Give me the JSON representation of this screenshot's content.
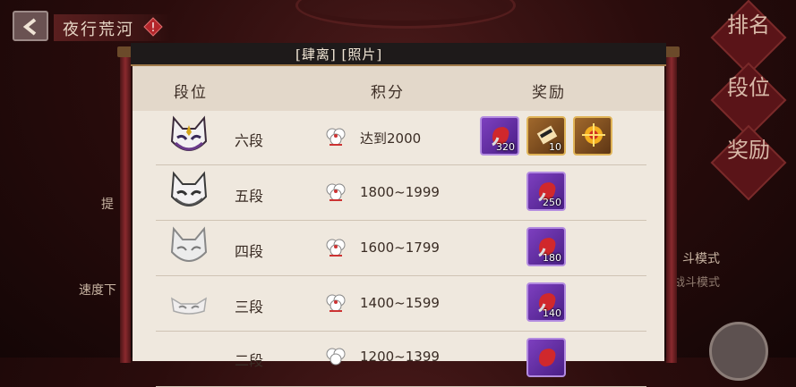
{
  "header": {
    "title": "夜行荒河"
  },
  "side_banners": [
    "排名",
    "段位",
    "奖励"
  ],
  "background_texts": {
    "left_1": "提",
    "left_2": "速度下",
    "right_1": "斗模式",
    "right_2": "战斗模式"
  },
  "scroll": {
    "title": "[肆离] [照片]"
  },
  "table": {
    "headers": {
      "rank": "段位",
      "score": "积分",
      "reward": "奖励"
    },
    "rows": [
      {
        "rank": "六段",
        "score": "达到2000",
        "rewards": [
          {
            "type": "purple",
            "icon": "red-bird-icon",
            "count": "320"
          },
          {
            "type": "gold",
            "icon": "scroll-item-icon",
            "count": "10"
          },
          {
            "type": "gold",
            "icon": "spark-item-icon",
            "count": ""
          }
        ]
      },
      {
        "rank": "五段",
        "score": "1800~1999",
        "rewards": [
          {
            "type": "purple",
            "icon": "red-bird-icon",
            "count": "250"
          }
        ]
      },
      {
        "rank": "四段",
        "score": "1600~1799",
        "rewards": [
          {
            "type": "purple",
            "icon": "red-bird-icon",
            "count": "180"
          }
        ]
      },
      {
        "rank": "三段",
        "score": "1400~1599",
        "rewards": [
          {
            "type": "purple",
            "icon": "red-bird-icon",
            "count": "140"
          }
        ]
      },
      {
        "rank": "二段",
        "score": "1200~1399",
        "rewards": [
          {
            "type": "purple",
            "icon": "red-bird-icon",
            "count": ""
          }
        ]
      }
    ]
  }
}
